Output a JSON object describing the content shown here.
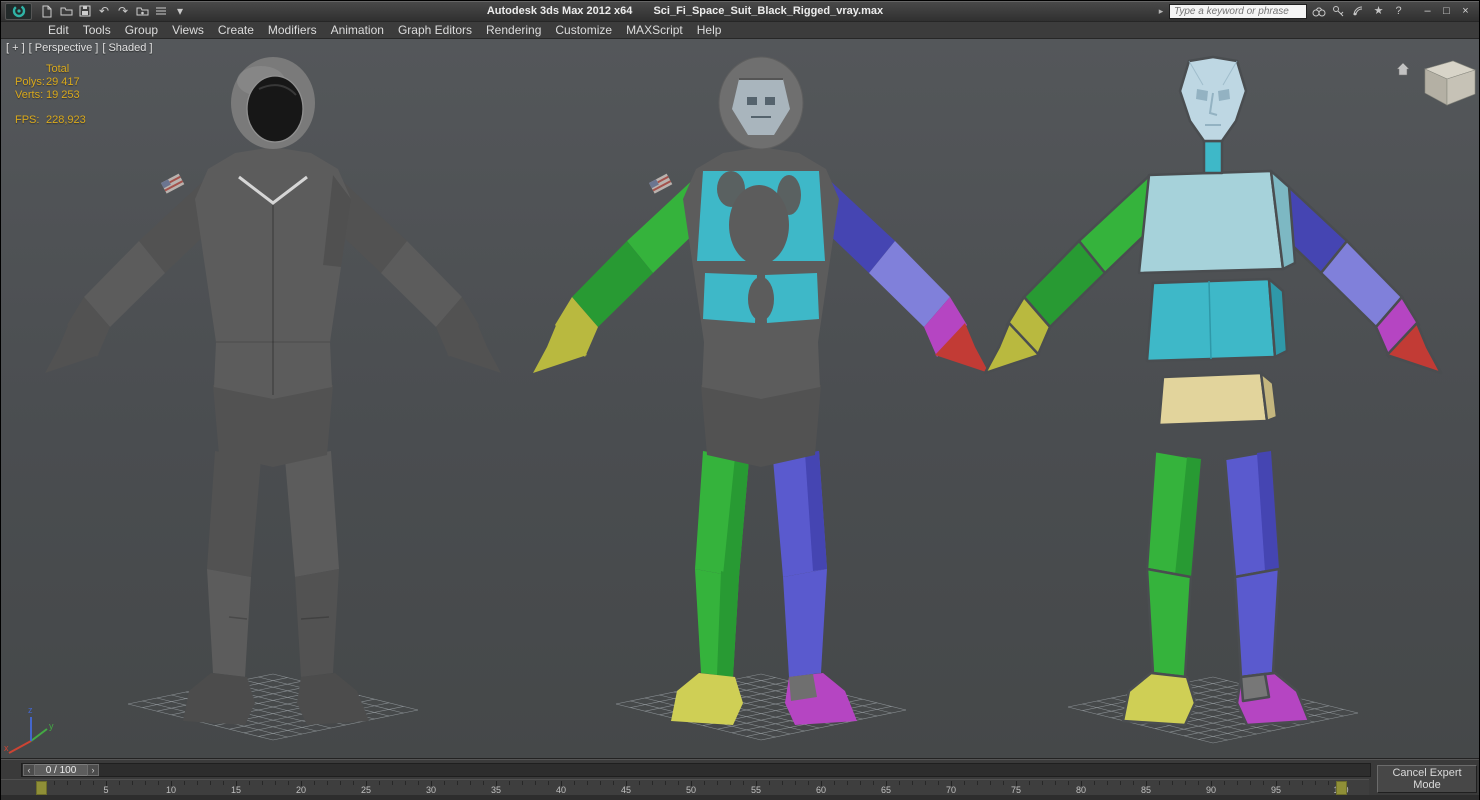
{
  "window": {
    "title_app": "Autodesk 3ds Max  2012 x64",
    "title_file": "Sci_Fi_Space_Suit_Black_Rigged_vray.max"
  },
  "infocenter": {
    "search_placeholder": "Type a keyword or phrase"
  },
  "menubar": {
    "items": [
      "Edit",
      "Tools",
      "Group",
      "Views",
      "Create",
      "Modifiers",
      "Animation",
      "Graph Editors",
      "Rendering",
      "Customize",
      "MAXScript",
      "Help"
    ]
  },
  "viewport": {
    "label_segments": [
      "[ + ]",
      "[ Perspective ]",
      "[ Shaded ]"
    ],
    "stats": {
      "total_label": "Total",
      "polys_label": "Polys:",
      "polys_value": "29 417",
      "verts_label": "Verts:",
      "verts_value": "19 253",
      "fps_label": "FPS:",
      "fps_value": "228,923"
    }
  },
  "timeline": {
    "slider_value": "0 / 100",
    "tick_min": 0,
    "tick_max": 100,
    "tick_step": 5
  },
  "statusbar": {
    "cancel_expert_label": "Cancel Expert Mode"
  },
  "axis": {
    "x": "x",
    "y": "y",
    "z": "z"
  },
  "glyphs": {
    "undo": "↶",
    "redo": "↷",
    "caret": "▾",
    "search_history": "▸",
    "star": "★",
    "help": "?",
    "minimize": "–",
    "maximize": "□",
    "close": "×",
    "slider_prev": "‹",
    "slider_next": "›"
  },
  "colors": {
    "bg": "#4a4d50",
    "grid": "#9aa0a4",
    "stats_text": "#d9a91c",
    "suit": "#5c5c5c",
    "suitDark": "#525252",
    "boot": "#4c4c4c",
    "helmet": "#7a7a7a",
    "visor": "#171717",
    "trim": "#d6d6d6",
    "face": "#a9b5bd",
    "faceDark": "#55636d",
    "green": "#35b33c",
    "greenDark": "#289a33",
    "cyan": "#3eb8c8",
    "cyanDark": "#2f98a8",
    "chest": "#a6d2da",
    "chestDark": "#7db8c3",
    "headBlue": "#bed7e3",
    "headShade": "#93b2c2",
    "indigo": "#5a5ace",
    "indigoDark": "#4545b2",
    "periwinkle": "#8080da",
    "yellow": "#cfcf55",
    "olive": "#b9b93f",
    "tan": "#e2d49c",
    "tanDark": "#c4b67e",
    "magenta": "#b545c2",
    "red": "#c23b35"
  }
}
